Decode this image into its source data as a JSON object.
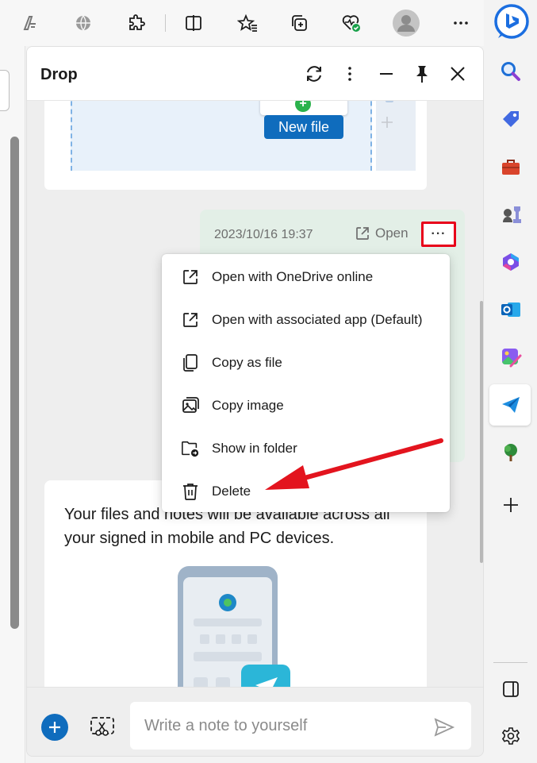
{
  "pane": {
    "title": "Drop",
    "upload_button_label": "New file",
    "message": {
      "timestamp": "2023/10/16 19:37",
      "open_label": "Open",
      "more_label": "···"
    },
    "info_text": "Your files and notes will be available across all your signed in mobile and PC devices.",
    "note_placeholder": "Write a note to yourself"
  },
  "menu": {
    "items": [
      {
        "label": "Open with OneDrive online",
        "icon": "open-external-icon"
      },
      {
        "label": "Open with associated app (Default)",
        "icon": "open-external-icon"
      },
      {
        "label": "Copy as file",
        "icon": "copy-icon"
      },
      {
        "label": "Copy image",
        "icon": "image-icon"
      },
      {
        "label": "Show in folder",
        "icon": "folder-icon"
      },
      {
        "label": "Delete",
        "icon": "trash-icon"
      }
    ]
  },
  "toolbar": {
    "icons": [
      "read-aloud-icon",
      "translate-globe-icon",
      "extensions-icon",
      "split-screen-icon",
      "favorites-icon",
      "collections-icon",
      "browser-essentials-icon",
      "profile-avatar",
      "more-icon",
      "bing-copilot-icon"
    ]
  },
  "sidebar": {
    "icons": [
      "search-icon",
      "shopping-icon",
      "tools-icon",
      "games-icon",
      "microsoft-365-icon",
      "outlook-icon",
      "designer-icon",
      "drop-icon",
      "tree-icon",
      "add-icon",
      "split-icon",
      "settings-icon"
    ]
  },
  "colors": {
    "accent": "#0f6cbd",
    "highlight_red": "#e8001a",
    "arrow_red": "#e3141e",
    "bubble_green": "#e3efe7"
  }
}
